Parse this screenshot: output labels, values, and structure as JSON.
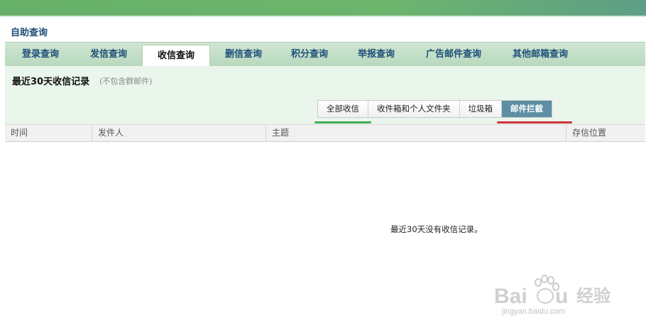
{
  "page_title": "自助查询",
  "tabs": [
    {
      "label": "登录查询",
      "active": false
    },
    {
      "label": "发信查询",
      "active": false
    },
    {
      "label": "收信查询",
      "active": true
    },
    {
      "label": "删信查询",
      "active": false
    },
    {
      "label": "积分查询",
      "active": false
    },
    {
      "label": "举报查询",
      "active": false
    },
    {
      "label": "广告邮件查询",
      "active": false
    },
    {
      "label": "其他邮箱查询",
      "active": false
    }
  ],
  "records": {
    "title": "最近30天收信记录",
    "note": "(不包含群邮件)"
  },
  "filters": [
    {
      "label": "全部收信",
      "active": false
    },
    {
      "label": "收件箱和个人文件夹",
      "active": false
    },
    {
      "label": "垃圾箱",
      "active": false
    },
    {
      "label": "邮件拦截",
      "active": true
    }
  ],
  "table": {
    "columns": [
      "时间",
      "发件人",
      "主题",
      "存信位置"
    ]
  },
  "empty_message": "最近30天没有收信记录。",
  "watermark": {
    "logo": "Baidu经验",
    "url": "jingyan.baidu.com"
  },
  "colors": {
    "top_bar": "#67b06a",
    "tab_text": "#1f4e79",
    "filter_active": "#5d8ea3",
    "annotation_red": "#d0323a",
    "annotation_green": "#3fae4e"
  }
}
